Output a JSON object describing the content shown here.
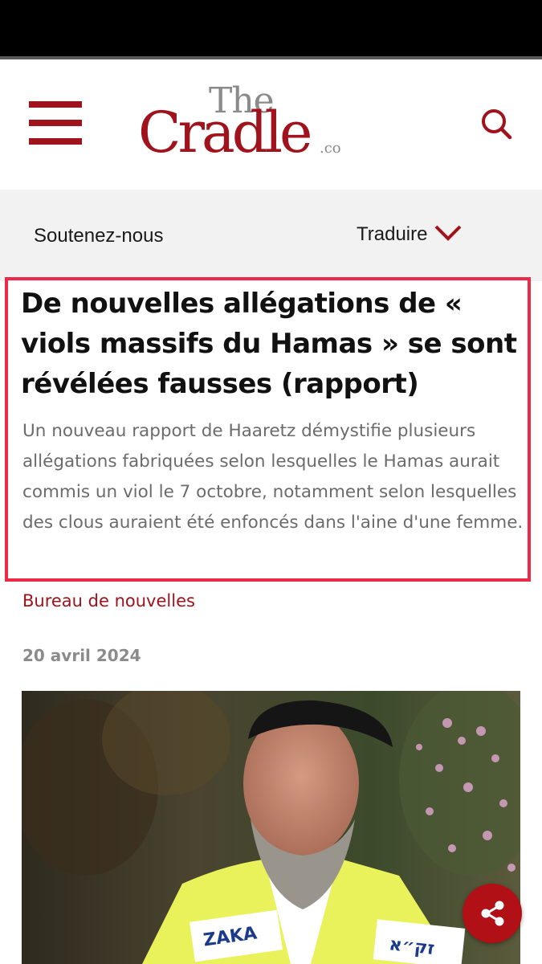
{
  "header": {
    "menu_icon": "hamburger-menu-icon",
    "logo": {
      "the": "The",
      "cradle": "Cradle",
      "co": ".co"
    },
    "search_icon": "search-icon"
  },
  "subnav": {
    "support_label": "Soutenez-nous",
    "translate_label": "Traduire",
    "translate_icon": "chevron-down-icon"
  },
  "article": {
    "title": "De nouvelles allégations de « viols massifs du Hamas » se sont révélées fausses (rapport)",
    "summary": "Un nouveau rapport de Haaretz démystifie plusieurs allégations fabriquées selon lesquelles le Hamas aurait commis un viol le 7 octobre, notamment selon lesquelles des clous auraient été enfoncés dans l'aine d'une femme.",
    "category": "Bureau de nouvelles",
    "date": "20 avril 2024",
    "image_badge_left": "ZAKA",
    "image_badge_right": "זק״א"
  },
  "colors": {
    "brand_red": "#a0131c",
    "highlight_border": "#ec2a48",
    "share_button": "#b01016"
  },
  "share_icon": "share-icon"
}
